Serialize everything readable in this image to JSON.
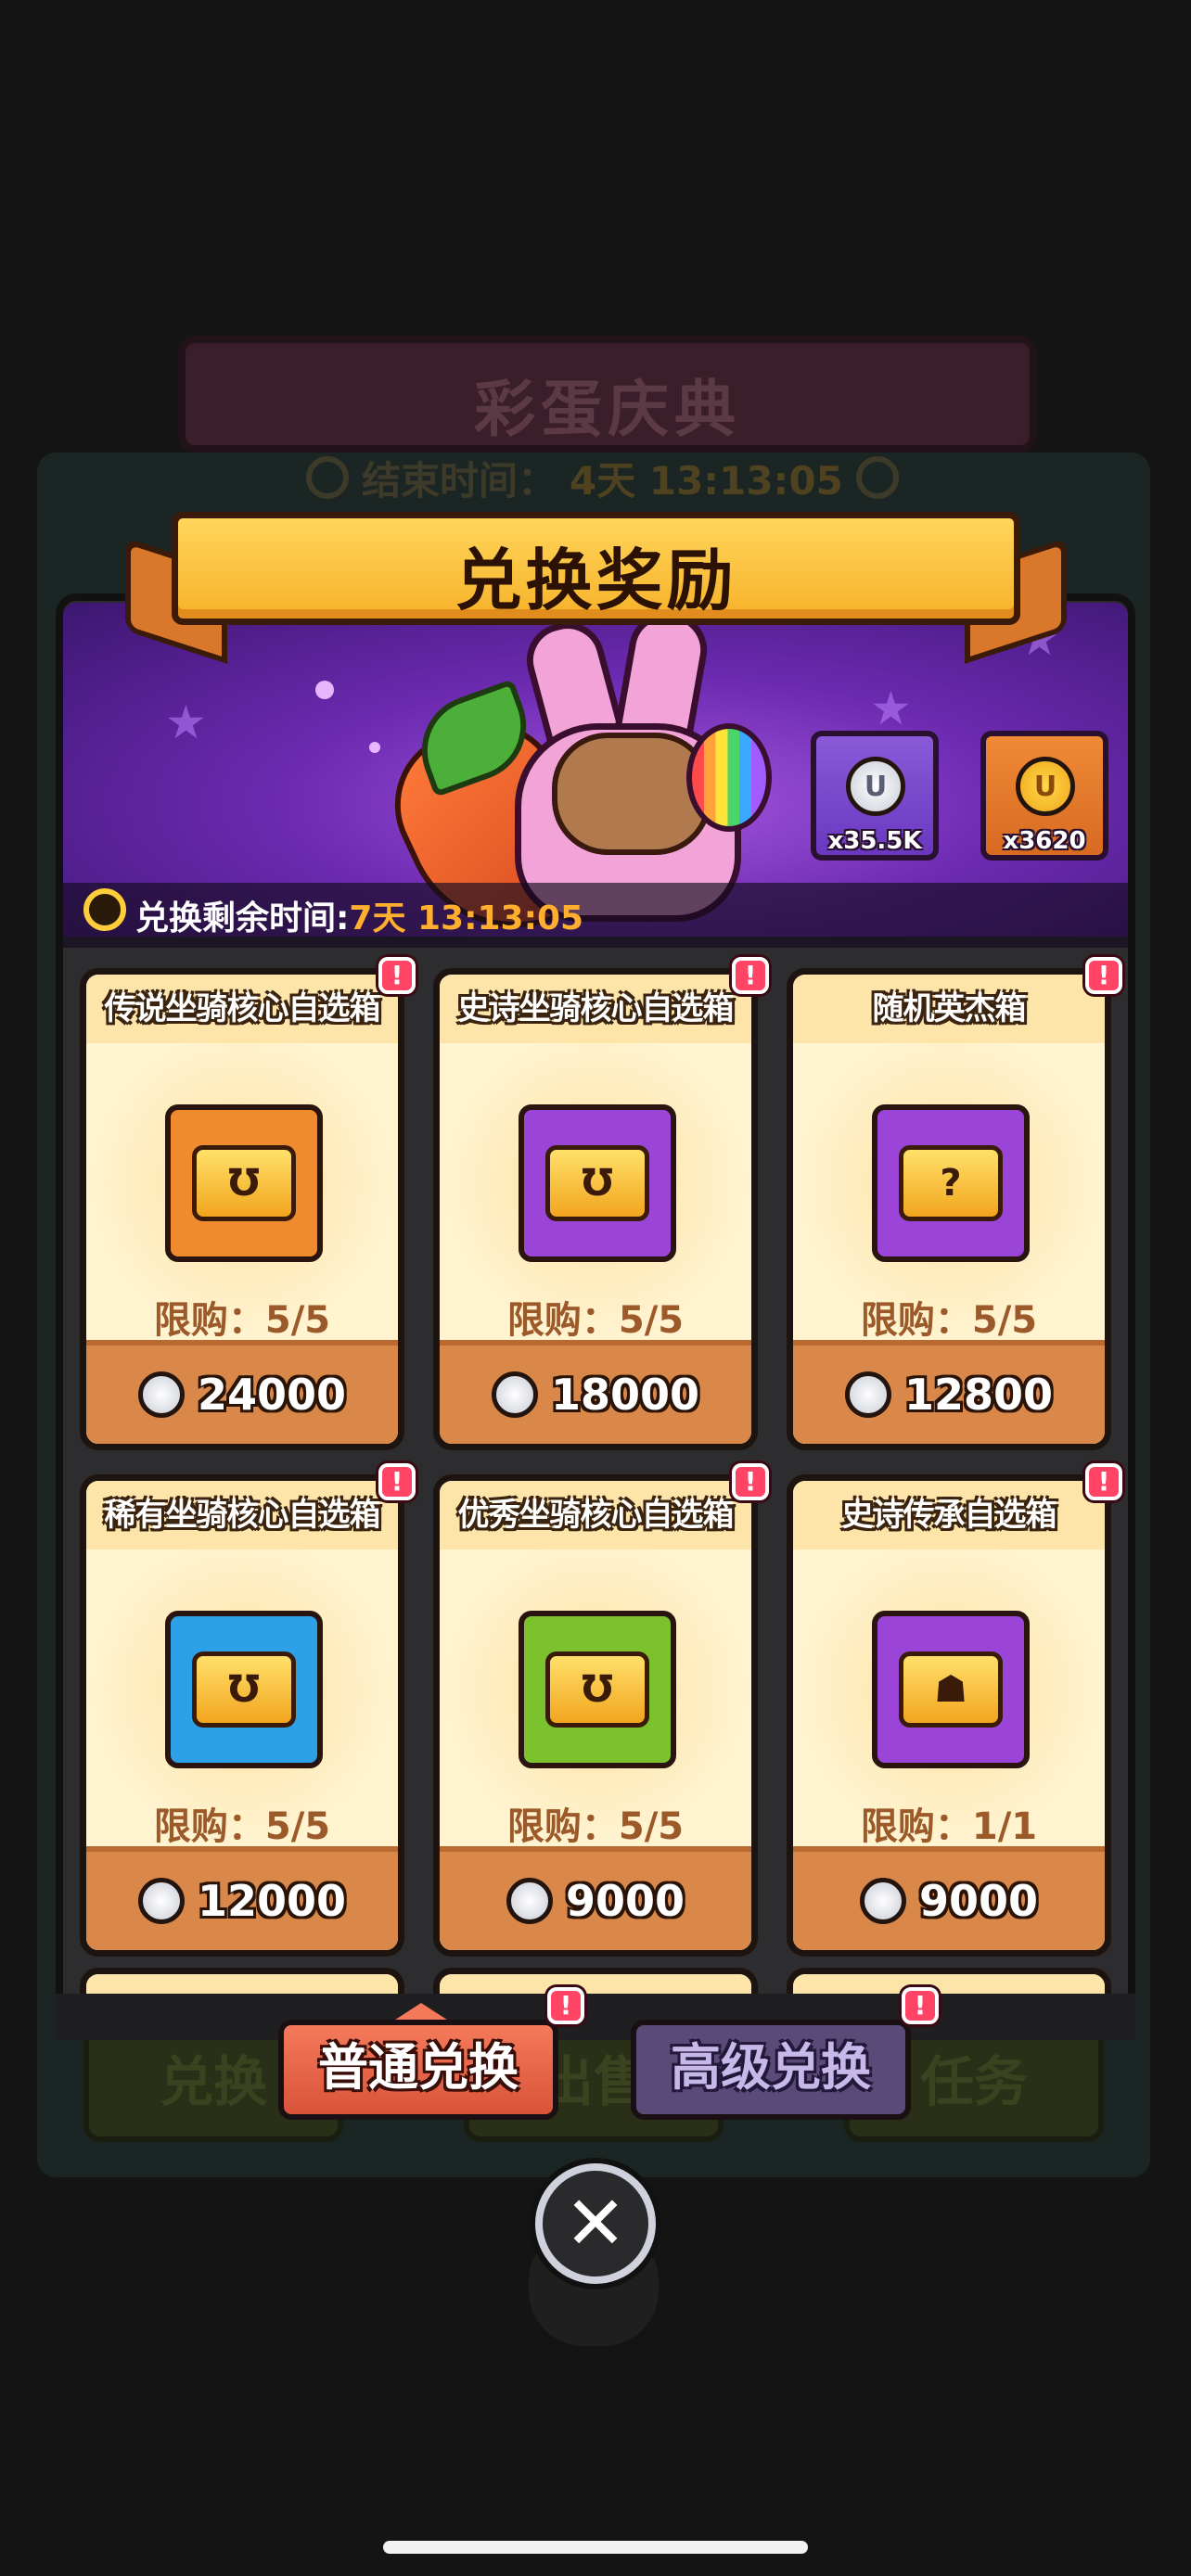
{
  "background": {
    "event_title": "彩蛋庆典",
    "end_time_label": "结束时间：",
    "end_time_value": "4天 13:13:05",
    "help_icon": "question-icon",
    "tab_left": "兑换",
    "tab_right": "任务",
    "tab_middle": "出售"
  },
  "panel": {
    "title": "兑换奖励",
    "remaining_label": "兑换剩余时间:",
    "remaining_value": "7天 13:13:05"
  },
  "currencies": [
    {
      "name": "silver-rabbit-coin",
      "amount": "x35.5K",
      "color": "#7a48cc"
    },
    {
      "name": "gold-rabbit-coin",
      "amount": "x3620",
      "color": "#e27a2c"
    }
  ],
  "items": [
    {
      "title": "传说坐骑核心自选箱",
      "limit": "限购：5/5",
      "price": "24000",
      "chest_color": "#f08a2e",
      "chest_icon": "horseshoe-chest-icon",
      "badge": "!"
    },
    {
      "title": "史诗坐骑核心自选箱",
      "limit": "限购：5/5",
      "price": "18000",
      "chest_color": "#9a45d8",
      "chest_icon": "horseshoe-chest-icon",
      "badge": "!"
    },
    {
      "title": "随机英杰箱",
      "limit": "限购：5/5",
      "price": "12800",
      "chest_color": "#9a45d8",
      "chest_icon": "mystery-chest-icon",
      "badge": "!"
    },
    {
      "title": "稀有坐骑核心自选箱",
      "limit": "限购：5/5",
      "price": "12000",
      "chest_color": "#2ea0e8",
      "chest_icon": "horseshoe-chest-icon",
      "badge": "!"
    },
    {
      "title": "优秀坐骑核心自选箱",
      "limit": "限购：5/5",
      "price": "9000",
      "chest_color": "#7cc22e",
      "chest_icon": "horseshoe-chest-icon",
      "badge": "!"
    },
    {
      "title": "史诗传承自选箱",
      "limit": "限购：1/1",
      "price": "9000",
      "chest_color": "#9a45d8",
      "chest_icon": "cat-emblem-chest-icon",
      "badge": "!"
    }
  ],
  "tabs": {
    "normal": "普通兑换",
    "advanced": "高级兑换",
    "normal_badge": "!",
    "advanced_badge": "!"
  },
  "close_icon": "close-icon"
}
